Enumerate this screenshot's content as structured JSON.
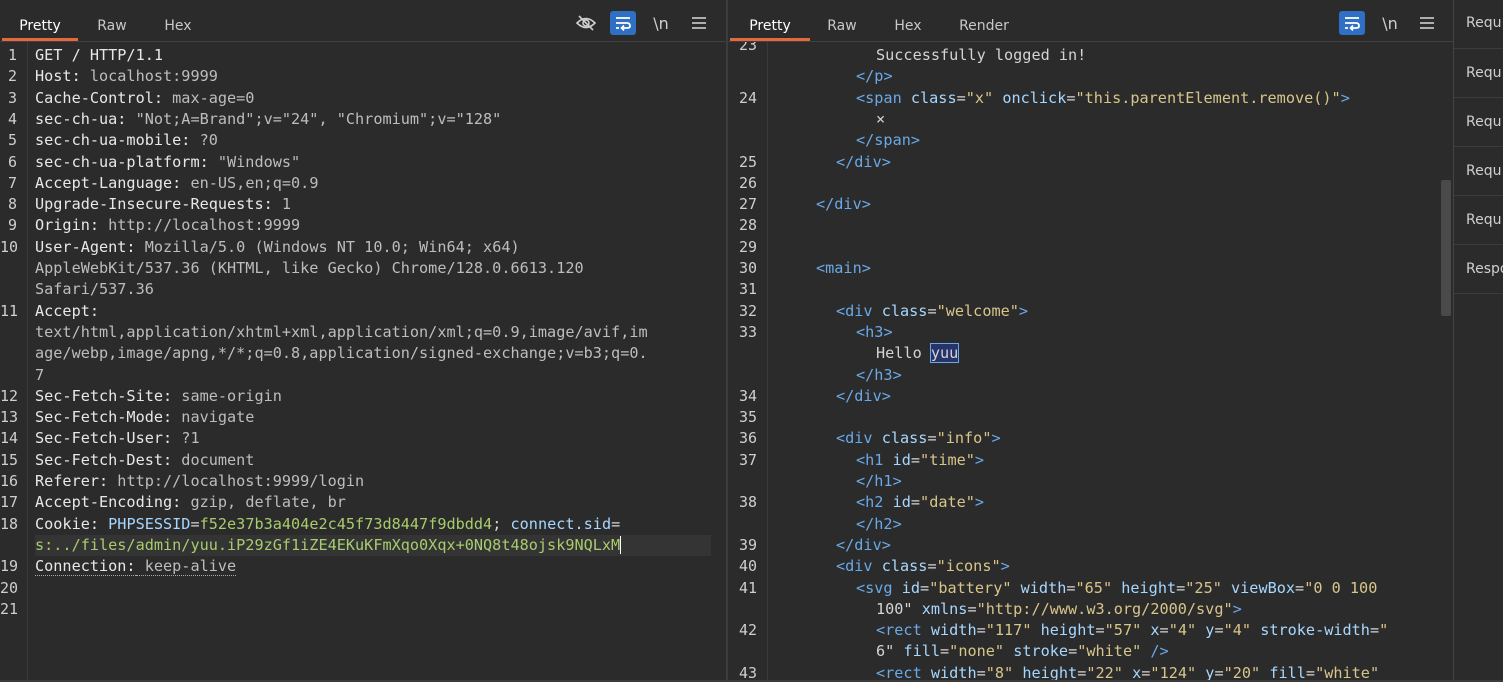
{
  "request": {
    "tabs": [
      "Pretty",
      "Raw",
      "Hex"
    ],
    "active_tab": "Pretty",
    "icons": [
      "eye-off-icon",
      "wrap-icon",
      "newline-icon",
      "menu-icon"
    ],
    "newline_label": "\\n",
    "line_numbers": [
      "1",
      "2",
      "3",
      "4",
      "5",
      "6",
      "7",
      "8",
      "9",
      "10",
      "11",
      "12",
      "13",
      "14",
      "15",
      "16",
      "17",
      "18",
      "19",
      "20",
      "21"
    ],
    "lines": [
      {
        "num": "1",
        "key": "GET / HTTP/1.1",
        "val": ""
      },
      {
        "num": "2",
        "key": "Host:",
        "val": " localhost:9999"
      },
      {
        "num": "3",
        "key": "Cache-Control:",
        "val": " max-age=0"
      },
      {
        "num": "4",
        "key": "sec-ch-ua:",
        "val": " \"Not;A=Brand\";v=\"24\", \"Chromium\";v=\"128\""
      },
      {
        "num": "5",
        "key": "sec-ch-ua-mobile:",
        "val": " ?0"
      },
      {
        "num": "6",
        "key": "sec-ch-ua-platform:",
        "val": " \"Windows\""
      },
      {
        "num": "7",
        "key": "Accept-Language:",
        "val": " en-US,en;q=0.9"
      },
      {
        "num": "8",
        "key": "Upgrade-Insecure-Requests:",
        "val": " 1"
      },
      {
        "num": "9",
        "key": "Origin:",
        "val": " http://localhost:9999"
      },
      {
        "num": "10",
        "key": "User-Agent:",
        "val": " Mozilla/5.0 (Windows NT 10.0; Win64; x64)"
      },
      {
        "num": "",
        "key": "",
        "val": "AppleWebKit/537.36 (KHTML, like Gecko) Chrome/128.0.6613.120"
      },
      {
        "num": "",
        "key": "",
        "val": "Safari/537.36"
      },
      {
        "num": "11",
        "key": "Accept:",
        "val": ""
      },
      {
        "num": "",
        "key": "",
        "val": "text/html,application/xhtml+xml,application/xml;q=0.9,image/avif,im"
      },
      {
        "num": "",
        "key": "",
        "val": "age/webp,image/apng,*/*;q=0.8,application/signed-exchange;v=b3;q=0."
      },
      {
        "num": "",
        "key": "",
        "val": "7"
      },
      {
        "num": "12",
        "key": "Sec-Fetch-Site:",
        "val": " same-origin"
      },
      {
        "num": "13",
        "key": "Sec-Fetch-Mode:",
        "val": " navigate"
      },
      {
        "num": "14",
        "key": "Sec-Fetch-User:",
        "val": " ?1"
      },
      {
        "num": "15",
        "key": "Sec-Fetch-Dest:",
        "val": " document"
      },
      {
        "num": "16",
        "key": "Referer:",
        "val": " http://localhost:9999/login"
      },
      {
        "num": "17",
        "key": "Accept-Encoding:",
        "val": " gzip, deflate, br"
      }
    ],
    "cookie": {
      "num": "18",
      "key": "Cookie:",
      "name1": "PHPSESSID",
      "val1": "f52e37b3a404e2c45f73d8447f9dbdd4",
      "sep": "; ",
      "name2": "connect.sid",
      "val2": "s:../files/admin/yuu.iP29zGf1iZE4EKuKFmXqo0Xqx+0NQ8t48ojsk9NQLxM"
    },
    "connection": {
      "num": "19",
      "key": "Connection:",
      "val": " keep-alive"
    },
    "tail_numbers": [
      "20",
      "21"
    ]
  },
  "response": {
    "tabs": [
      "Pretty",
      "Raw",
      "Hex",
      "Render"
    ],
    "active_tab": "Pretty",
    "newline_label": "\\n",
    "lines": [
      {
        "num": "",
        "html": "    Successfully logged in!"
      },
      {
        "num": "",
        "html": "  </p>"
      },
      {
        "num": "24",
        "html": "  <span class=\"x\" onclick=\"this.parentElement.remove()\">"
      },
      {
        "num": "",
        "html": "    ×"
      },
      {
        "num": "",
        "html": "  </span>"
      },
      {
        "num": "25",
        "html": "</div>"
      },
      {
        "num": "26",
        "html": ""
      },
      {
        "num": "27",
        "html": "</div>"
      },
      {
        "num": "28",
        "html": ""
      },
      {
        "num": "29",
        "html": ""
      },
      {
        "num": "30",
        "html": "<main>"
      },
      {
        "num": "31",
        "html": ""
      },
      {
        "num": "32",
        "html": "<div class=\"welcome\">"
      },
      {
        "num": "33",
        "html": "<h3>"
      },
      {
        "num": "",
        "html": "Hello yuu"
      },
      {
        "num": "",
        "html": "</h3>"
      },
      {
        "num": "34",
        "html": "</div>"
      },
      {
        "num": "35",
        "html": ""
      },
      {
        "num": "36",
        "html": "<div class=\"info\">"
      },
      {
        "num": "37",
        "html": "<h1 id=\"time\">"
      },
      {
        "num": "",
        "html": "</h1>"
      },
      {
        "num": "38",
        "html": "<h2 id=\"date\">"
      },
      {
        "num": "",
        "html": "</h2>"
      },
      {
        "num": "39",
        "html": "</div>"
      },
      {
        "num": "40",
        "html": "<div class=\"icons\">"
      },
      {
        "num": "41",
        "html": "<svg id=\"battery\" width=\"65\" height=\"25\" viewBox=\"0 0 100"
      },
      {
        "num": "",
        "html": "100\" xmlns=\"http://www.w3.org/2000/svg\">"
      },
      {
        "num": "42",
        "html": "<rect width=\"117\" height=\"57\" x=\"4\" y=\"4\" stroke-width=\""
      },
      {
        "num": "",
        "html": "6\" fill=\"none\" stroke=\"white\" />"
      },
      {
        "num": "43",
        "html": "<rect width=\"8\" height=\"22\" x=\"124\" y=\"20\" fill=\"white\""
      }
    ]
  },
  "side_panel": {
    "items": [
      "Requ",
      "Requ",
      "Requ",
      "Requ",
      "Requ",
      "Respo"
    ]
  }
}
